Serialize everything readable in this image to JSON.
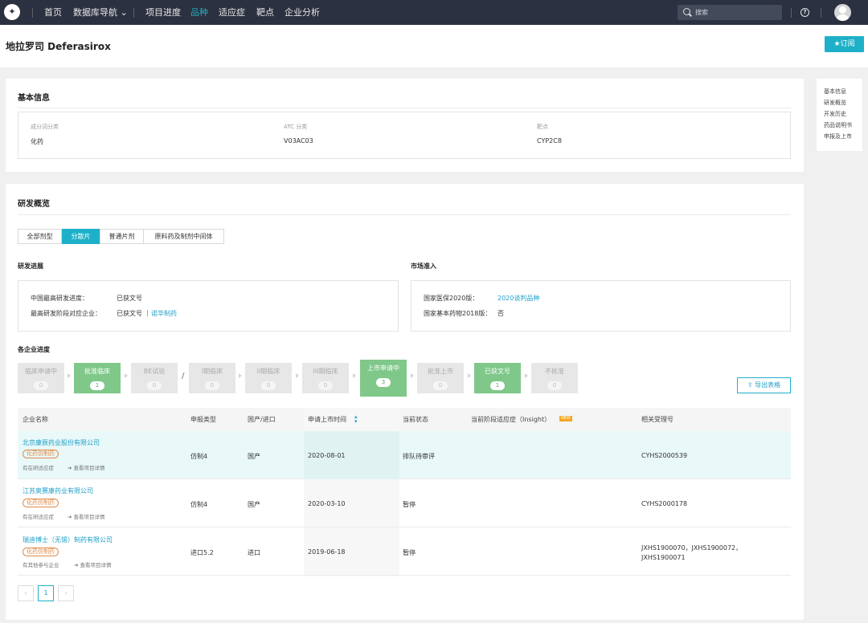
{
  "nav": {
    "logo_glyph": "✦",
    "items": [
      "首页",
      "数据库导航 ⌄",
      "项目进度",
      "品种",
      "适应症",
      "靶点",
      "企业分析"
    ],
    "active_index": 3,
    "search_placeholder": "搜索",
    "help_glyph": "?"
  },
  "page": {
    "title": "地拉罗司 Deferasirox",
    "subscribe": "★订阅"
  },
  "sidenav": [
    "基本信息",
    "研发概览",
    "开发历史",
    "药品说明书",
    "申报及上市"
  ],
  "basic": {
    "heading": "基本信息",
    "fields": [
      {
        "label": "成分词分类",
        "value": "化药"
      },
      {
        "label": "ATC 分类",
        "value": "V03AC03"
      },
      {
        "label": "靶点",
        "value": "CYP2C8"
      }
    ]
  },
  "rd": {
    "heading": "研发概览",
    "tabs": [
      "全部剂型",
      "分散片",
      "普通片剂",
      "原料药及制剂中间体"
    ],
    "active_tab": 1,
    "progress": {
      "heading": "研发进展",
      "row1_label": "中国最高研发进度：",
      "row1_value": "已获文号",
      "row2_label": "最高研发阶段对应企业：",
      "row2_value": "已获文号",
      "row2_sep": "|",
      "row2_link": "诺华制药"
    },
    "market": {
      "heading": "市场准入",
      "row1_label": "国家医保2020版：",
      "row1_link": "2020谈判品种",
      "row2_label": "国家基本药物2018版：",
      "row2_value": "否"
    }
  },
  "stages": {
    "heading": "各企业进度",
    "sep": "/",
    "items": [
      {
        "label": "临床申请中",
        "count": "0"
      },
      {
        "label": "批准临床",
        "count": "1"
      },
      {
        "label": "BE试验",
        "count": "0"
      },
      {
        "label": "I期临床",
        "count": "0"
      },
      {
        "label": "II期临床",
        "count": "0"
      },
      {
        "label": "III期临床",
        "count": "0"
      },
      {
        "label": "上市申请中",
        "count": "3"
      },
      {
        "label": "批准上市",
        "count": "0"
      },
      {
        "label": "已获文号",
        "count": "1"
      },
      {
        "label": "不批准",
        "count": "0"
      }
    ],
    "export": "导出表格"
  },
  "table": {
    "headers": [
      "企业名称",
      "申报类型",
      "国产/进口",
      "申请上市时间",
      "当前状态",
      "当前阶段适应症（Insight）",
      "相关受理号"
    ],
    "new_badge": "NEW",
    "rows": [
      {
        "company": "北京康辰药业股份有限公司",
        "tag": "化药仿制药",
        "link1": "有在研适应症",
        "link2": "查看项目详情",
        "type": "仿制4",
        "origin": "国产",
        "date": "2020-08-01",
        "status": "排队待审评",
        "numbers": "CYHS2000539"
      },
      {
        "company": "江苏奥赛康药业有限公司",
        "tag": "化药仿制药",
        "link1": "有在研适应症",
        "link2": "查看项目详情",
        "type": "仿制4",
        "origin": "国产",
        "date": "2020-03-10",
        "status": "暂停",
        "numbers": "CYHS2000178"
      },
      {
        "company": "瑞迪博士（无锡）制药有限公司",
        "tag": "化药仿制药",
        "link1": "有其他参与企业",
        "link2": "查看项目详情",
        "type": "进口5.2",
        "origin": "进口",
        "date": "2019-06-18",
        "status": "暂停",
        "numbers": "JXHS1900070，JXHS1900072，",
        "numbers2": "JXHS1900071"
      }
    ]
  },
  "pagination": {
    "prev": "‹",
    "current": "1",
    "next": "›"
  }
}
